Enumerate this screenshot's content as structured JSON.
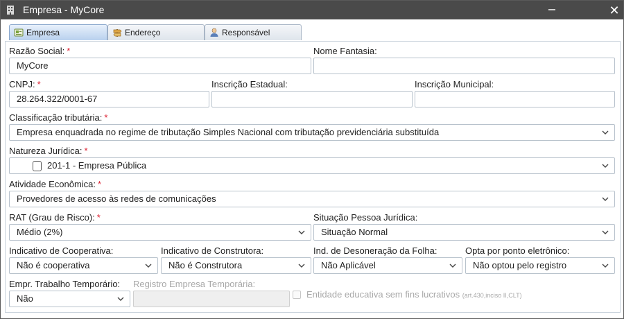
{
  "window": {
    "title": "Empresa - MyCore"
  },
  "tabs": [
    "Empresa",
    "Endereço",
    "Responsável"
  ],
  "fields": {
    "razao_social": {
      "label": "Razão Social:",
      "value": "MyCore"
    },
    "nome_fantasia": {
      "label": "Nome Fantasia:",
      "value": ""
    },
    "cnpj": {
      "label": "CNPJ:",
      "value": "28.264.322/0001-67"
    },
    "inscricao_estadual": {
      "label": "Inscrição Estadual:",
      "value": ""
    },
    "inscricao_municipal": {
      "label": "Inscrição Municipal:",
      "value": ""
    },
    "classificacao": {
      "label": "Classificação tributária:",
      "value": "Empresa enquadrada no regime de tributação Simples Nacional com tributação previdenciária substituída"
    },
    "natureza": {
      "label": "Natureza Jurídica:",
      "value": "201-1 - Empresa Pública"
    },
    "atividade": {
      "label": "Atividade Econômica:",
      "value": "Provedores de acesso às redes de comunicações"
    },
    "rat": {
      "label": "RAT (Grau de Risco):",
      "value": "Médio (2%)"
    },
    "situacao": {
      "label": "Situação Pessoa Jurídica:",
      "value": "Situação Normal"
    },
    "cooperativa": {
      "label": "Indicativo de Cooperativa:",
      "value": "Não é cooperativa"
    },
    "construtora": {
      "label": "Indicativo de Construtora:",
      "value": "Não é Construtora"
    },
    "desoneracao": {
      "label": "Ind. de Desoneração da Folha:",
      "value": "Não Aplicável"
    },
    "ponto": {
      "label": "Opta por ponto eletrônico:",
      "value": "Não optou pelo registro"
    },
    "trabalho_temp": {
      "label": "Empr. Trabalho Temporário:",
      "value": "Não"
    },
    "registro_temp": {
      "label": "Registro Empresa Temporária:",
      "value": ""
    },
    "entidade": {
      "label": "Entidade educativa sem fins lucrativos",
      "note": "(art.430,inciso II,CLT)"
    }
  },
  "required_mark": "*",
  "colors": {
    "titlebar": "#4a4a4a",
    "required": "#dd2233",
    "active_tab": "#b9d1ee"
  }
}
